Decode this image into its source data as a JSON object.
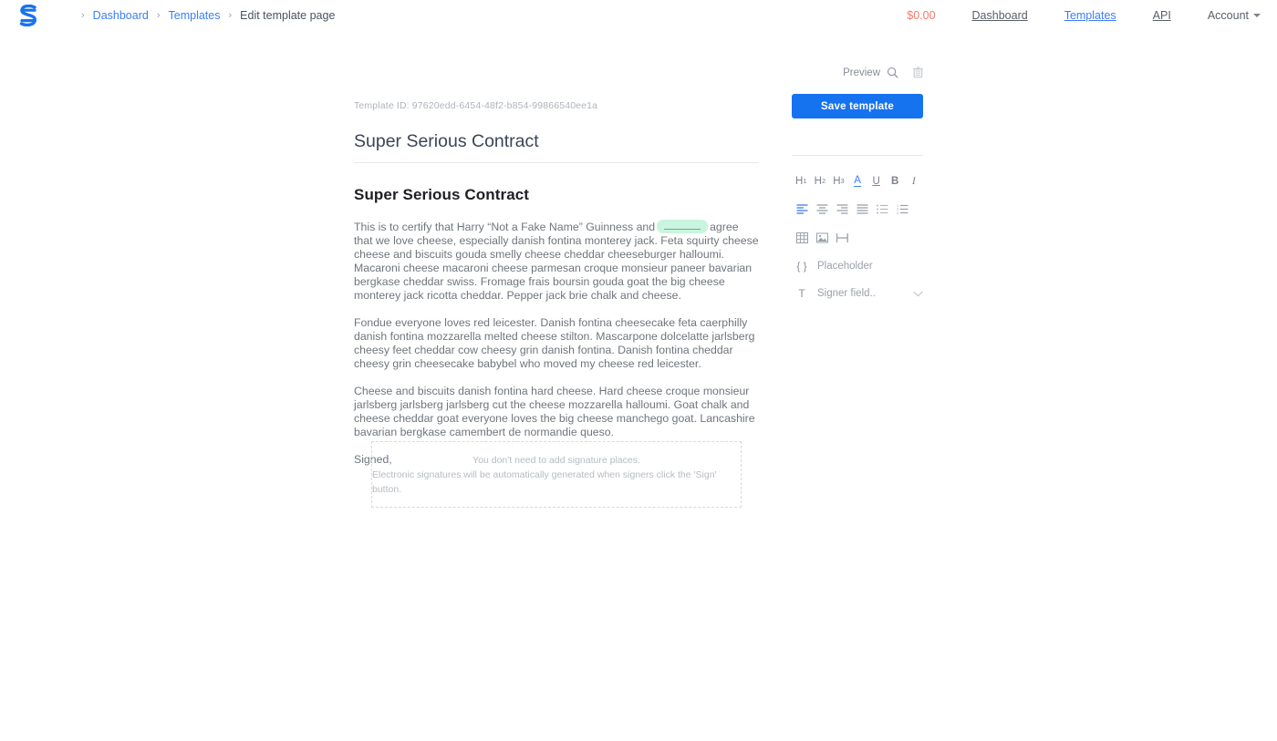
{
  "brand": {
    "logo_icon": "logo-s-icon",
    "accent": "#1673f0",
    "link": "#3d7df6"
  },
  "breadcrumb": {
    "sep": "›",
    "items": [
      {
        "label": "Dashboard",
        "type": "link"
      },
      {
        "label": "Templates",
        "type": "link"
      },
      {
        "label": "Edit template page",
        "type": "current"
      }
    ]
  },
  "topnav": {
    "balance": "$0.00",
    "balance_color": "#f4796b",
    "items": [
      {
        "label": "Dashboard",
        "active": false
      },
      {
        "label": "Templates",
        "active": true
      },
      {
        "label": "API",
        "active": false
      },
      {
        "label": "Account",
        "active": false,
        "caret": true
      }
    ]
  },
  "document": {
    "template_id_label": "Template ID: 97620edd-6454-48f2-b854-99866540ee1a",
    "title": "Super Serious Contract",
    "heading": "Super Serious Contract",
    "paragraph1_before": "This is to certify that Harry “Not a Fake Name” Guinness and",
    "paragraph1_after": "agree that we love cheese, especially danish fontina monterey jack. Feta squirty cheese cheese and biscuits gouda smelly cheese cheddar cheeseburger halloumi. Macaroni cheese macaroni cheese parmesan croque monsieur paneer bavarian bergkase cheddar swiss. Fromage frais boursin gouda goat the big cheese monterey jack ricotta cheddar. Pepper jack brie chalk and cheese.",
    "placeholder_field_color": "#c9f5de",
    "paragraph2": "Fondue everyone loves red leicester. Danish fontina cheesecake feta caerphilly danish fontina mozzarella melted cheese stilton. Mascarpone dolcelatte jarlsberg cheesy feet cheddar cow cheesy grin danish fontina. Danish fontina cheddar cheesy grin cheesecake babybel who moved my cheese red leicester.",
    "paragraph3": "Cheese and biscuits danish fontina hard cheese. Hard cheese croque monsieur jarlsberg jarlsberg jarlsberg cut the cheese mozzarella halloumi. Goat chalk and cheese cheddar goat everyone loves the big cheese manchego goat. Lancashire bavarian bergkase camembert de normandie queso.",
    "paragraph4": "Signed,"
  },
  "signature_box": {
    "line1": "You don't need to add signature places.",
    "line2": "Electronic signatures will be automatically generated when signers click the 'Sign' button."
  },
  "panel": {
    "preview_label": "Preview",
    "preview_icon": "magnifier-icon",
    "delete_icon": "trash-icon",
    "save_label": "Save template",
    "toolbar": {
      "row1": [
        {
          "name": "heading-1-button",
          "glyph": "H",
          "sup": "1",
          "active": false
        },
        {
          "name": "heading-2-button",
          "glyph": "H",
          "sup": "2",
          "active": false
        },
        {
          "name": "heading-3-button",
          "glyph": "H",
          "sup": "3",
          "active": false
        },
        {
          "name": "text-color-button",
          "glyph": "A",
          "sup": "",
          "active": true
        },
        {
          "name": "underline-button",
          "glyph": "U",
          "sup": "",
          "active": false
        },
        {
          "name": "bold-button",
          "glyph": "B",
          "sup": "",
          "active": false
        },
        {
          "name": "italic-button",
          "glyph": "I",
          "sup": "",
          "active": false
        }
      ],
      "row2": [
        {
          "name": "align-left-button",
          "active": true
        },
        {
          "name": "align-center-button",
          "active": false
        },
        {
          "name": "align-right-button",
          "active": false
        },
        {
          "name": "align-justify-button",
          "active": false
        },
        {
          "name": "bullet-list-button",
          "active": false
        },
        {
          "name": "numbered-list-button",
          "active": false
        }
      ],
      "row3": [
        {
          "name": "insert-table-button"
        },
        {
          "name": "insert-image-button"
        },
        {
          "name": "insert-horizontal-rule-button"
        }
      ]
    },
    "placeholder_option": {
      "icon": "braces-icon",
      "icon_glyph": "{ }",
      "label": "Placeholder"
    },
    "signer_field_option": {
      "icon": "text-field-icon",
      "icon_glyph": "T",
      "label": "Signer field..",
      "chevron": "chevron-down-icon"
    }
  }
}
